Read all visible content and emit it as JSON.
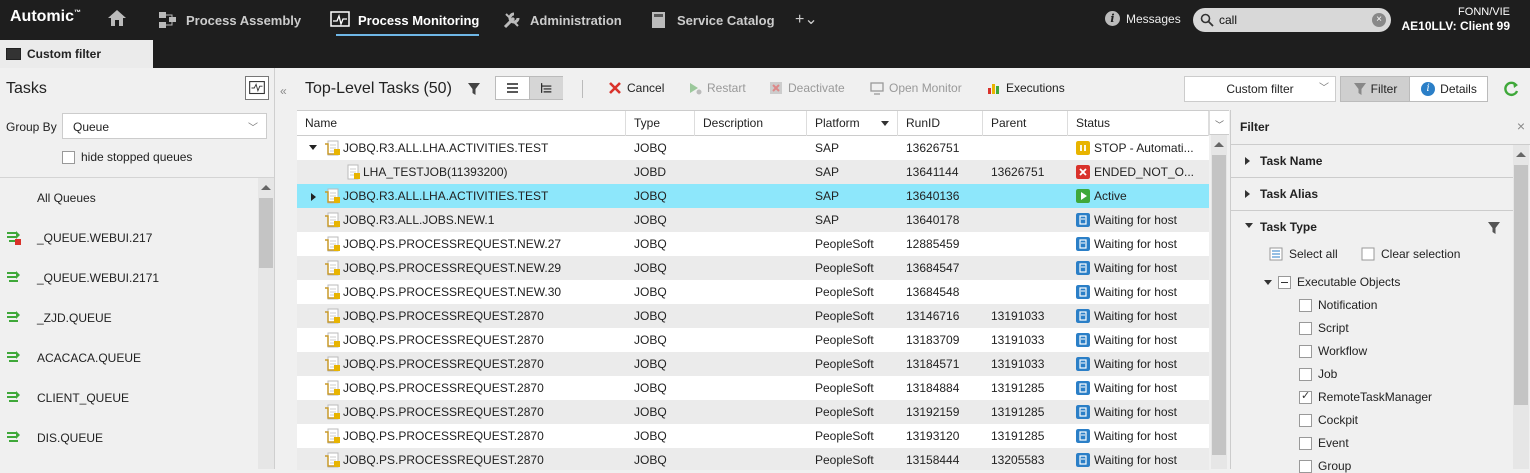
{
  "app": {
    "logo": "Automic",
    "nav": [
      {
        "label": "Process Assembly"
      },
      {
        "label": "Process Monitoring"
      },
      {
        "label": "Administration"
      },
      {
        "label": "Service Catalog"
      }
    ],
    "add_label": "+⌄",
    "messages_label": "Messages",
    "search_value": "call",
    "user_line1": "FONN/VIE",
    "user_line2": "AE10LLV: Client 99"
  },
  "tab": {
    "label": "Custom filter"
  },
  "left": {
    "title": "Tasks",
    "group_by_label": "Group By",
    "group_by_value": "Queue",
    "hide_stopped_label": "hide stopped queues",
    "queues": [
      {
        "label": "All Queues",
        "icon": "none"
      },
      {
        "label": "_QUEUE.WEBUI.217",
        "icon": "queue-stopped-icon"
      },
      {
        "label": "_QUEUE.WEBUI.2171",
        "icon": "queue-icon"
      },
      {
        "label": "_ZJD.QUEUE",
        "icon": "queue-icon"
      },
      {
        "label": "ACACACA.QUEUE",
        "icon": "queue-icon"
      },
      {
        "label": "CLIENT_QUEUE",
        "icon": "queue-icon"
      },
      {
        "label": "DIS.QUEUE",
        "icon": "queue-icon"
      }
    ]
  },
  "main": {
    "title": "Top-Level Tasks",
    "count": "(50)",
    "toolbar": {
      "cancel": "Cancel",
      "restart": "Restart",
      "deactivate": "Deactivate",
      "open_monitor": "Open Monitor",
      "executions": "Executions",
      "custom_filter": "Custom filter",
      "filter": "Filter",
      "details": "Details"
    },
    "columns": [
      "Name",
      "Type",
      "Description",
      "Platform",
      "RunID",
      "Parent",
      "Status"
    ],
    "rows": [
      {
        "name": "JOBQ.R3.ALL.LHA.ACTIVITIES.TEST",
        "type": "JOBQ",
        "description": "",
        "platform": "SAP",
        "runid": "13626751",
        "parent": "",
        "status": "STOP - Automati...",
        "status_kind": "stop",
        "expander": "down",
        "indent": 0
      },
      {
        "name": "LHA_TESTJOB(11393200)",
        "type": "JOBD",
        "description": "",
        "platform": "SAP",
        "runid": "13641144",
        "parent": "13626751",
        "status": "ENDED_NOT_O...",
        "status_kind": "error",
        "expander": "",
        "indent": 1
      },
      {
        "name": "JOBQ.R3.ALL.LHA.ACTIVITIES.TEST",
        "type": "JOBQ",
        "description": "",
        "platform": "SAP",
        "runid": "13640136",
        "parent": "",
        "status": "Active",
        "status_kind": "active",
        "expander": "right",
        "indent": 0
      },
      {
        "name": "JOBQ.R3.ALL.JOBS.NEW.1",
        "type": "JOBQ",
        "description": "",
        "platform": "SAP",
        "runid": "13640178",
        "parent": "",
        "status": "Waiting for host",
        "status_kind": "waiting",
        "expander": "",
        "indent": 0
      },
      {
        "name": "JOBQ.PS.PROCESSREQUEST.NEW.27",
        "type": "JOBQ",
        "description": "",
        "platform": "PeopleSoft",
        "runid": "12885459",
        "parent": "",
        "status": "Waiting for host",
        "status_kind": "waiting",
        "expander": "",
        "indent": 0
      },
      {
        "name": "JOBQ.PS.PROCESSREQUEST.NEW.29",
        "type": "JOBQ",
        "description": "",
        "platform": "PeopleSoft",
        "runid": "13684547",
        "parent": "",
        "status": "Waiting for host",
        "status_kind": "waiting",
        "expander": "",
        "indent": 0
      },
      {
        "name": "JOBQ.PS.PROCESSREQUEST.NEW.30",
        "type": "JOBQ",
        "description": "",
        "platform": "PeopleSoft",
        "runid": "13684548",
        "parent": "",
        "status": "Waiting for host",
        "status_kind": "waiting",
        "expander": "",
        "indent": 0
      },
      {
        "name": "JOBQ.PS.PROCESSREQUEST.2870",
        "type": "JOBQ",
        "description": "",
        "platform": "PeopleSoft",
        "runid": "13146716",
        "parent": "13191033",
        "status": "Waiting for host",
        "status_kind": "waiting",
        "expander": "",
        "indent": 0
      },
      {
        "name": "JOBQ.PS.PROCESSREQUEST.2870",
        "type": "JOBQ",
        "description": "",
        "platform": "PeopleSoft",
        "runid": "13183709",
        "parent": "13191033",
        "status": "Waiting for host",
        "status_kind": "waiting",
        "expander": "",
        "indent": 0
      },
      {
        "name": "JOBQ.PS.PROCESSREQUEST.2870",
        "type": "JOBQ",
        "description": "",
        "platform": "PeopleSoft",
        "runid": "13184571",
        "parent": "13191033",
        "status": "Waiting for host",
        "status_kind": "waiting",
        "expander": "",
        "indent": 0
      },
      {
        "name": "JOBQ.PS.PROCESSREQUEST.2870",
        "type": "JOBQ",
        "description": "",
        "platform": "PeopleSoft",
        "runid": "13184884",
        "parent": "13191285",
        "status": "Waiting for host",
        "status_kind": "waiting",
        "expander": "",
        "indent": 0
      },
      {
        "name": "JOBQ.PS.PROCESSREQUEST.2870",
        "type": "JOBQ",
        "description": "",
        "platform": "PeopleSoft",
        "runid": "13192159",
        "parent": "13191285",
        "status": "Waiting for host",
        "status_kind": "waiting",
        "expander": "",
        "indent": 0
      },
      {
        "name": "JOBQ.PS.PROCESSREQUEST.2870",
        "type": "JOBQ",
        "description": "",
        "platform": "PeopleSoft",
        "runid": "13193120",
        "parent": "13191285",
        "status": "Waiting for host",
        "status_kind": "waiting",
        "expander": "",
        "indent": 0
      },
      {
        "name": "JOBQ.PS.PROCESSREQUEST.2870",
        "type": "JOBQ",
        "description": "",
        "platform": "PeopleSoft",
        "runid": "13158444",
        "parent": "13205583",
        "status": "Waiting for host",
        "status_kind": "waiting",
        "expander": "",
        "indent": 0
      }
    ]
  },
  "filter": {
    "title": "Filter",
    "close": "×",
    "sections": [
      "Task Name",
      "Task Alias",
      "Task Type"
    ],
    "select_all": "Select all",
    "clear_selection": "Clear selection",
    "group": "Executable Objects",
    "options": [
      {
        "label": "Notification",
        "checked": false
      },
      {
        "label": "Script",
        "checked": false
      },
      {
        "label": "Workflow",
        "checked": false
      },
      {
        "label": "Job",
        "checked": false
      },
      {
        "label": "RemoteTaskManager",
        "checked": true
      },
      {
        "label": "Cockpit",
        "checked": false
      },
      {
        "label": "Event",
        "checked": false
      },
      {
        "label": "Group",
        "checked": false
      }
    ]
  },
  "colors": {
    "topbar": "#1e1e1e",
    "selected_row": "#8de7fb",
    "active_underline": "#6fb7e6",
    "stop": "#e8b400",
    "error": "#d9322b",
    "active": "#3fa83a",
    "waiting": "#2b7fc7"
  }
}
